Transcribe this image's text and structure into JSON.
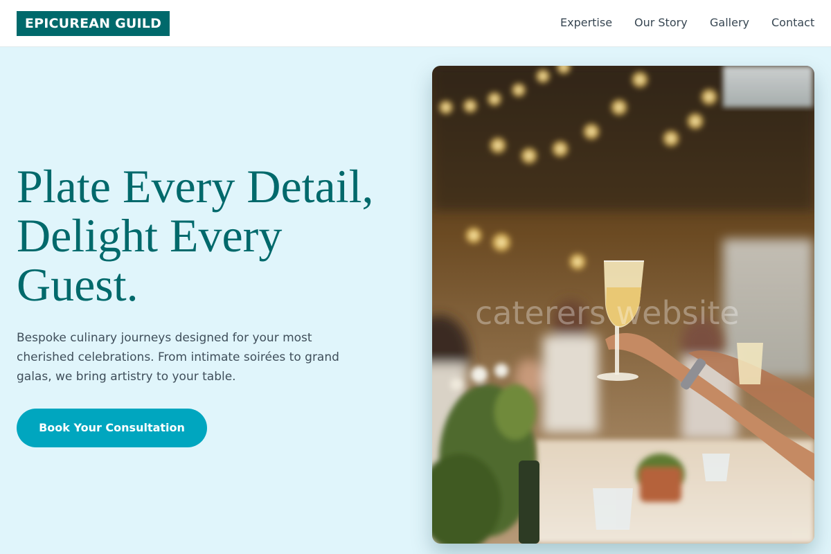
{
  "header": {
    "logo": "EPICUREAN GUILD",
    "nav": [
      "Expertise",
      "Our Story",
      "Gallery",
      "Contact"
    ]
  },
  "hero": {
    "headline": [
      "Plate Every Detail,",
      "Delight Every",
      "Guest."
    ],
    "subtext": [
      "Bespoke culinary journeys designed for your most",
      "cherished celebrations. From intimate soirées to grand",
      "galas, we bring artistry to your table."
    ],
    "cta": "Book Your Consultation",
    "image_watermark": "caterers website"
  },
  "colors": {
    "brand": "#00696b",
    "accent": "#00a6bf",
    "background": "#e0f5fb",
    "text": "#3f4e5a"
  }
}
